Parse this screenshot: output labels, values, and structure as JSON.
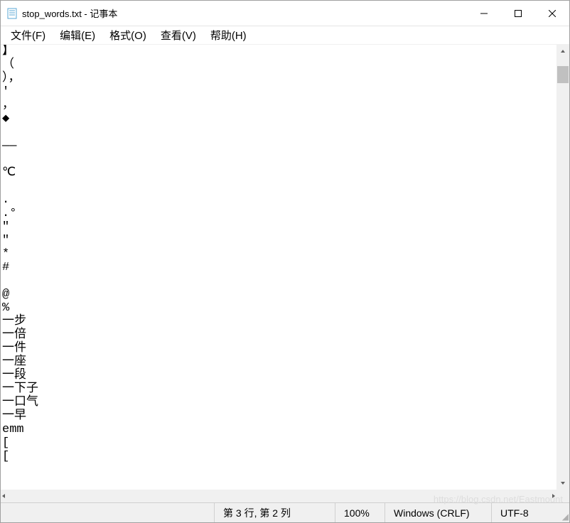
{
  "titlebar": {
    "title": "stop_words.txt - 记事本"
  },
  "menu": {
    "file": "文件(F)",
    "edit": "编辑(E)",
    "format": "格式(O)",
    "view": "查看(V)",
    "help": "帮助(H)"
  },
  "content": "】\n（\n），\n'\n，\n◆\n\n——\n\n℃\n\n.\n.°\n\"\n\"\n*\n#\n\n@\n%\n一步\n一倍\n一件\n一座\n一段\n一下子\n一口气\n一早\nemm\n[\n[",
  "status": {
    "position": "第 3 行, 第 2 列",
    "zoom": "100%",
    "line_ending": "Windows (CRLF)",
    "encoding": "UTF-8"
  },
  "watermark": "https://blog.csdn.net/Eastmount"
}
